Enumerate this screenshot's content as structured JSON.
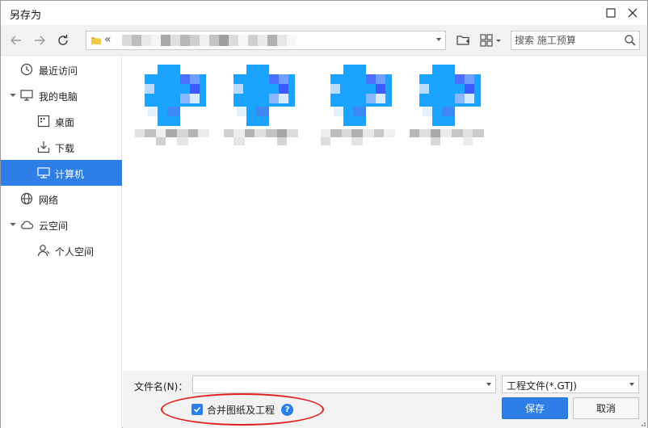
{
  "window": {
    "title": "另存为"
  },
  "titlebar": {
    "maximize_icon": "maximize-icon",
    "close_icon": "close-icon"
  },
  "toolbar": {
    "back_icon": "arrow-left-icon",
    "forward_icon": "arrow-right-icon",
    "refresh_icon": "refresh-icon",
    "address": {
      "chevron": "«",
      "path_obscured": true
    },
    "new_folder_icon": "new-folder-icon",
    "view_icon": "grid-view-icon",
    "search": {
      "placeholder": "搜索 施工预算",
      "icon": "search-icon"
    }
  },
  "sidebar": {
    "items": [
      {
        "label": "最近访问",
        "icon": "clock-icon"
      },
      {
        "label": "我的电脑",
        "icon": "monitor-icon",
        "expandable": true,
        "expanded": true
      },
      {
        "label": "桌面",
        "icon": "desktop-icon"
      },
      {
        "label": "下载",
        "icon": "download-icon"
      },
      {
        "label": "计算机",
        "icon": "computer-icon",
        "selected": true
      },
      {
        "label": "网络",
        "icon": "globe-icon"
      },
      {
        "label": "云空间",
        "icon": "cloud-icon",
        "expandable": true,
        "expanded": true
      },
      {
        "label": "个人空间",
        "icon": "user-icon"
      }
    ]
  },
  "files": [
    {
      "name_obscured": true,
      "thumb_obscured": true
    },
    {
      "name_obscured": true,
      "thumb_obscured": true
    },
    {
      "name_obscured": true,
      "thumb_obscured": true
    },
    {
      "name_obscured": true,
      "thumb_obscured": true
    }
  ],
  "bottom": {
    "filename_label": "文件名(N)：",
    "filename_value": "",
    "filetype_value": "工程文件(*.GTJ)",
    "merge_checkbox_label": "合并图纸及工程",
    "merge_checked": true,
    "help_glyph": "?",
    "save_label": "保存",
    "cancel_label": "取消"
  },
  "colors": {
    "accent": "#2d7ee6",
    "toolbar_bg": "#f2f2f2",
    "annotation": "#e02020"
  }
}
